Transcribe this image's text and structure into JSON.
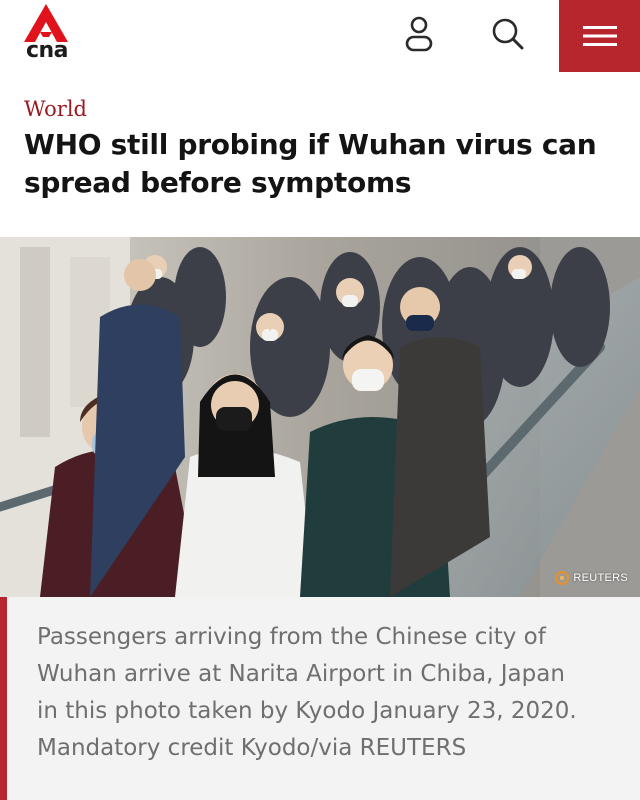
{
  "brand": {
    "logo_text": "cna",
    "accent_color": "#b7262d"
  },
  "header": {
    "icons": [
      "user-icon",
      "search-icon",
      "menu-icon"
    ]
  },
  "article": {
    "category": "World",
    "headline": "WHO still probing if Wuhan virus can spread before symptoms",
    "image_credit": "REUTERS",
    "caption": "Passengers arriving from the Chinese city of Wuhan arrive at Narita Airport in Chiba, Japan in this photo taken by Kyodo January 23, 2020. Mandatory credit Kyodo/via REUTERS"
  }
}
